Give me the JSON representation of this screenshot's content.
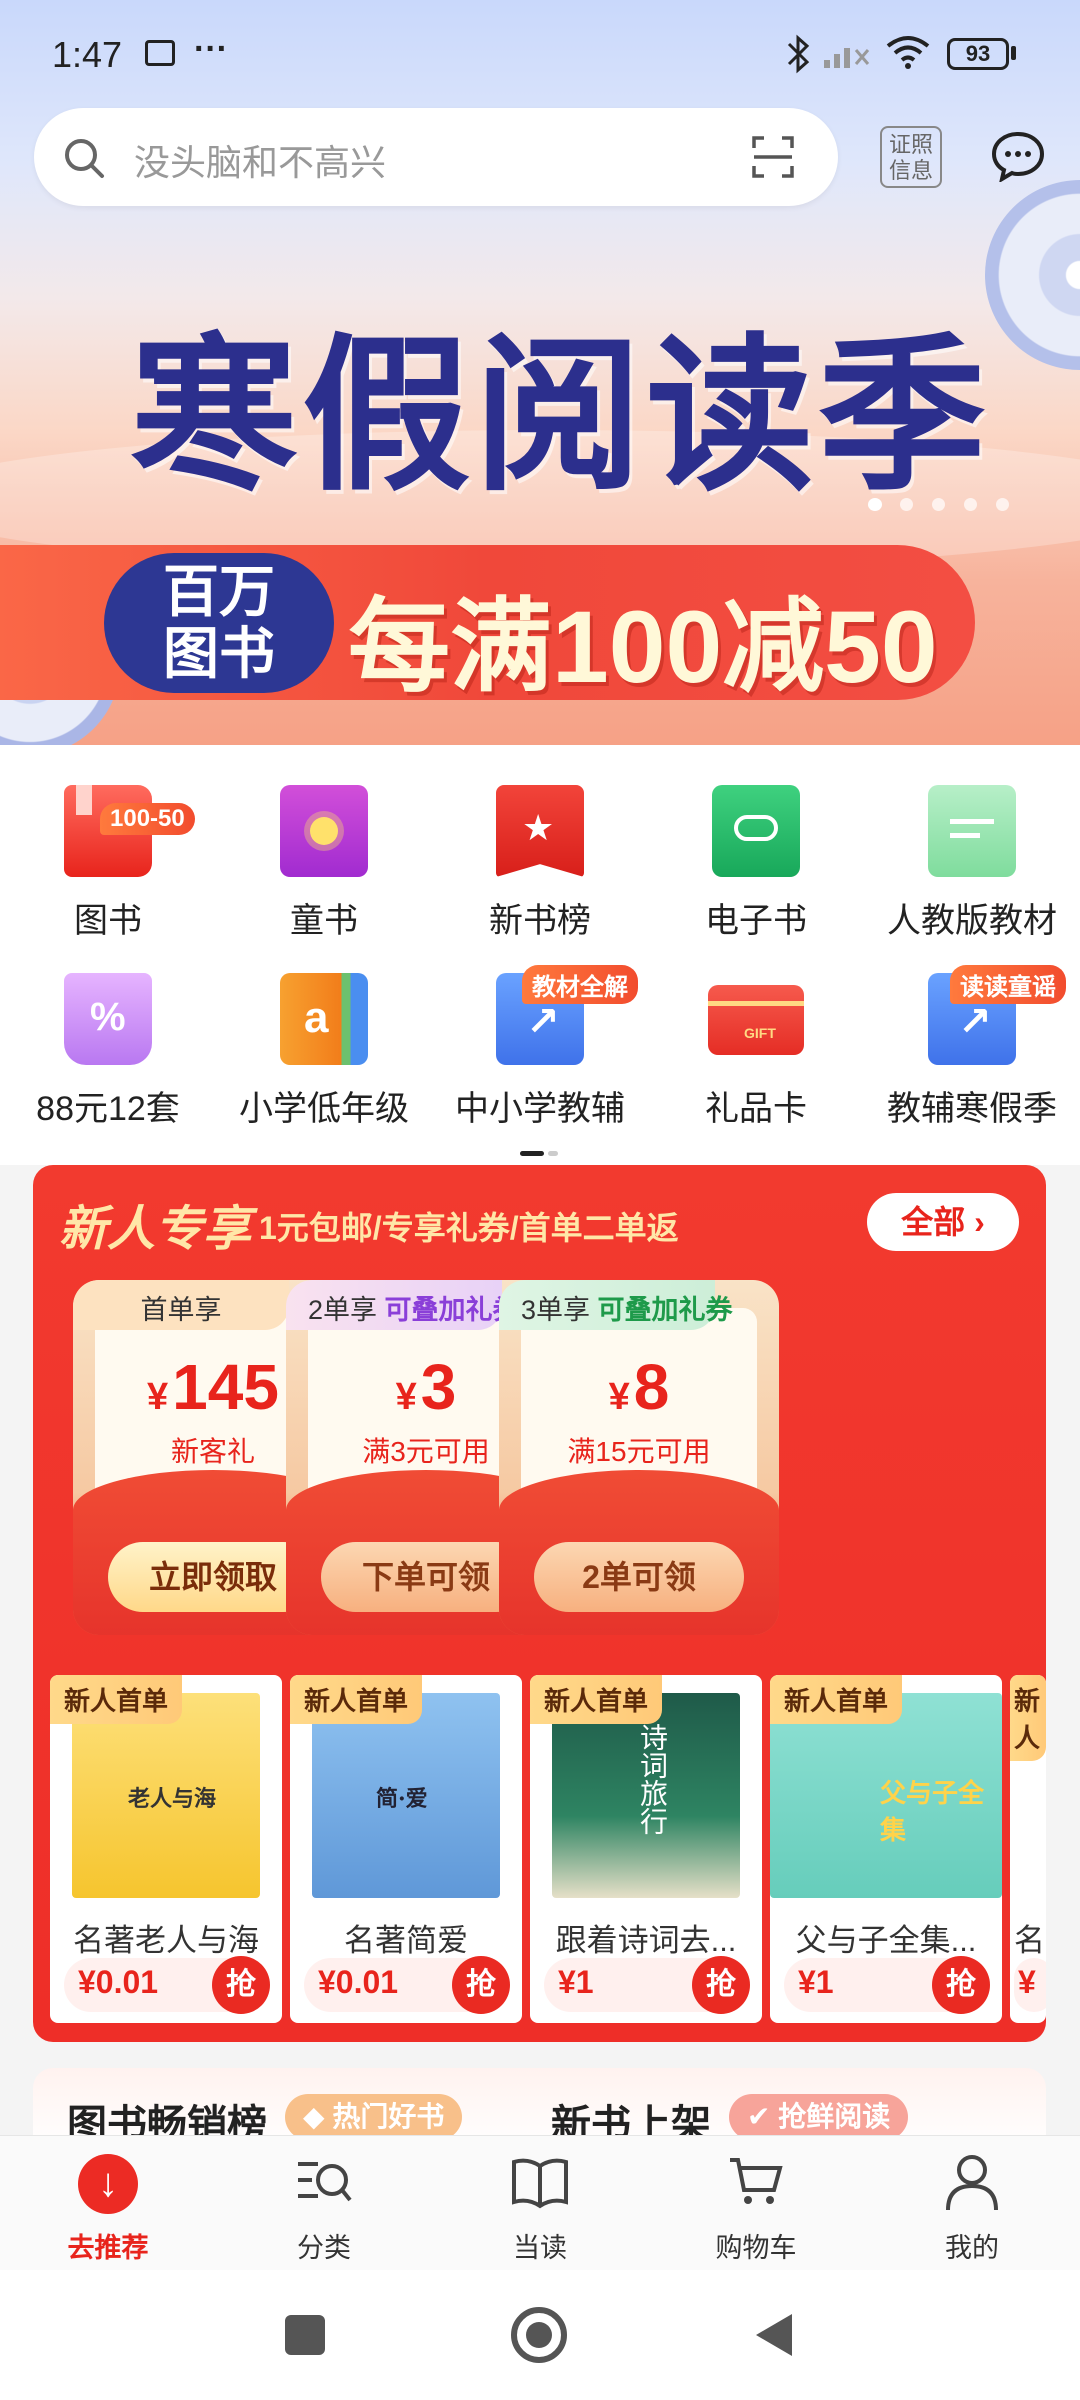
{
  "status_bar": {
    "time": "1:47",
    "more": "···",
    "battery": "93"
  },
  "search": {
    "placeholder": "没头脑和不高兴",
    "cert_label_1": "证照",
    "cert_label_2": "信息"
  },
  "hero": {
    "headline": "寒假阅读季",
    "badge_line1": "百万",
    "badge_line2": "图书",
    "promo_text": "每满100减50",
    "carousel_count": 5,
    "carousel_active": 0
  },
  "categories": [
    {
      "label": "图书",
      "tag": "100-50",
      "icon": "book-icon"
    },
    {
      "label": "童书",
      "tag": "",
      "icon": "kids-book-icon"
    },
    {
      "label": "新书榜",
      "tag": "",
      "icon": "ranking-icon"
    },
    {
      "label": "电子书",
      "tag": "",
      "icon": "ebook-icon"
    },
    {
      "label": "人教版教材",
      "tag": "",
      "icon": "textbook-icon"
    },
    {
      "label": "88元12套",
      "tag": "",
      "icon": "discount-basket-icon"
    },
    {
      "label": "小学低年级",
      "tag": "",
      "icon": "primary-school-icon"
    },
    {
      "label": "中小学教辅",
      "tag": "教材全解",
      "icon": "tutoring-icon"
    },
    {
      "label": "礼品卡",
      "tag": "",
      "icon": "gift-card-icon"
    },
    {
      "label": "教辅寒假季",
      "tag": "读读童谣",
      "icon": "winter-tutoring-icon"
    }
  ],
  "new_user": {
    "title": "新人专享",
    "subtitle": "1元包邮/专享礼券/首单二单返",
    "all_label": "全部",
    "coupons": [
      {
        "tab": "首单享",
        "tab_extra": "",
        "currency": "¥",
        "amount": "145",
        "condition": "新客礼",
        "button": "立即领取"
      },
      {
        "tab": "2单享",
        "tab_extra": "可叠加礼券",
        "currency": "¥",
        "amount": "3",
        "condition": "满3元可用",
        "button": "下单可领"
      },
      {
        "tab": "3单享",
        "tab_extra": "可叠加礼券",
        "currency": "¥",
        "amount": "8",
        "condition": "满15元可用",
        "button": "2单可领"
      }
    ],
    "products": [
      {
        "badge": "新人首单",
        "name": "名著老人与海",
        "price": "¥0.01",
        "grab": "抢",
        "cover_title": "老人与海"
      },
      {
        "badge": "新人首单",
        "name": "名著简爱",
        "price": "¥0.01",
        "grab": "抢",
        "cover_title": "简·爱"
      },
      {
        "badge": "新人首单",
        "name": "跟着诗词去...",
        "price": "¥1",
        "grab": "抢",
        "cover_title": "诗词旅行"
      },
      {
        "badge": "新人首单",
        "name": "父与子全集...",
        "price": "¥1",
        "grab": "抢",
        "cover_title": "父与子全集"
      },
      {
        "badge": "新人",
        "name": "名",
        "price": "¥",
        "grab": ""
      }
    ]
  },
  "sections": {
    "bestseller": "图书畅销榜",
    "bestseller_tag": "热门好书",
    "new_books": "新书上架",
    "new_books_tag": "抢鲜阅读"
  },
  "tab_bar": [
    {
      "label": "去推荐",
      "active": true,
      "icon": "recommend-icon"
    },
    {
      "label": "分类",
      "active": false,
      "icon": "category-icon"
    },
    {
      "label": "当读",
      "active": false,
      "icon": "read-icon"
    },
    {
      "label": "购物车",
      "active": false,
      "icon": "cart-icon"
    },
    {
      "label": "我的",
      "active": false,
      "icon": "profile-icon"
    }
  ],
  "colors": {
    "accent": "#e8241c",
    "panel_red": "#f0332a",
    "headline_navy": "#2c2f8d"
  }
}
